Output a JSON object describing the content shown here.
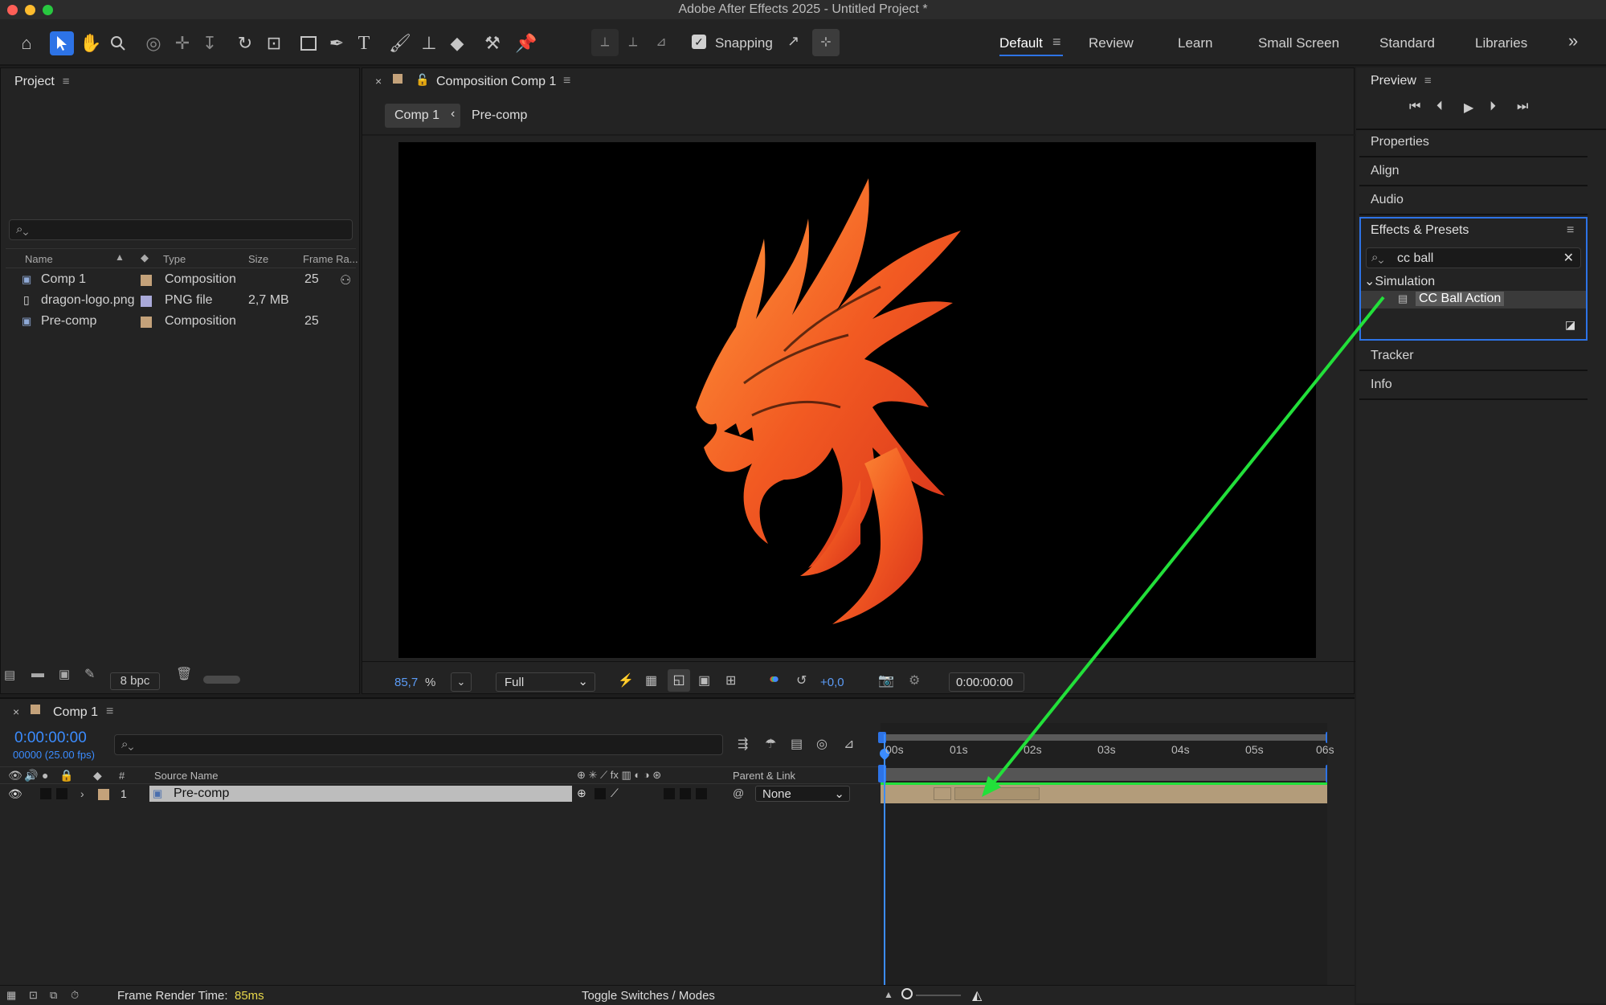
{
  "window": {
    "title": "Adobe After Effects 2025 - Untitled Project *"
  },
  "toolbar": {
    "snapping_label": "Snapping",
    "snapping_checked": true,
    "workspaces": [
      "Default",
      "Review",
      "Learn",
      "Small Screen",
      "Standard",
      "Libraries"
    ],
    "active_workspace": "Default",
    "tools": [
      "home-icon",
      "selection-tool-icon",
      "hand-tool-icon",
      "zoom-tool-icon",
      "orbit-camera-icon",
      "pan-camera-icon",
      "dolly-camera-icon",
      "rotation-tool-icon",
      "pan-behind-tool-icon",
      "rectangle-tool-icon",
      "pen-tool-icon",
      "type-tool-icon",
      "brush-tool-icon",
      "clone-stamp-icon",
      "eraser-tool-icon",
      "roto-brush-icon",
      "puppet-pin-icon"
    ]
  },
  "project": {
    "title": "Project",
    "search_placeholder": "",
    "columns": {
      "name": "Name",
      "type": "Type",
      "size": "Size",
      "frame_rate": "Frame Ra..."
    },
    "items": [
      {
        "name": "Comp 1",
        "type": "Composition",
        "size": "",
        "frame_rate": "25",
        "label_color": "#c4a27a",
        "icon": "composition-icon"
      },
      {
        "name": "dragon-logo.png",
        "type": "PNG file",
        "size": "2,7 MB",
        "frame_rate": "",
        "label_color": "#a9a9d9",
        "icon": "file-icon"
      },
      {
        "name": "Pre-comp",
        "type": "Composition",
        "size": "",
        "frame_rate": "25",
        "label_color": "#c4a27a",
        "icon": "composition-icon"
      }
    ],
    "bpc": "8 bpc"
  },
  "composition": {
    "title": "Composition Comp 1",
    "breadcrumbs": [
      "Comp 1",
      "Pre-comp"
    ],
    "zoom": "85,7",
    "zoom_unit": "%",
    "resolution": "Full",
    "exposure": "+0,0",
    "timecode": "0:00:00:00"
  },
  "right_panels": {
    "preview_title": "Preview",
    "properties": "Properties",
    "align": "Align",
    "audio": "Audio",
    "effects_title": "Effects & Presets",
    "effects_search": "cc ball",
    "category": "Simulation",
    "effect": "CC Ball Action",
    "tracker": "Tracker",
    "info": "Info"
  },
  "timeline": {
    "comp_tab": "Comp 1",
    "current_time": "0:00:00:00",
    "frame_info": "00000 (25.00 fps)",
    "columns": {
      "num": "#",
      "source_name": "Source Name",
      "parent": "Parent & Link"
    },
    "layers": [
      {
        "index": "1",
        "name": "Pre-comp",
        "parent": "None",
        "label_color": "#c4a27a"
      }
    ],
    "ruler": [
      "00s",
      "01s",
      "02s",
      "03s",
      "04s",
      "05s",
      "06s"
    ],
    "frame_render_label": "Frame Render Time:",
    "frame_render_value": "85ms",
    "toggle_label": "Toggle Switches / Modes"
  },
  "colors": {
    "accent": "#2d73e6",
    "arrow": "#22e03a",
    "layer_bar": "#b39c7a"
  }
}
